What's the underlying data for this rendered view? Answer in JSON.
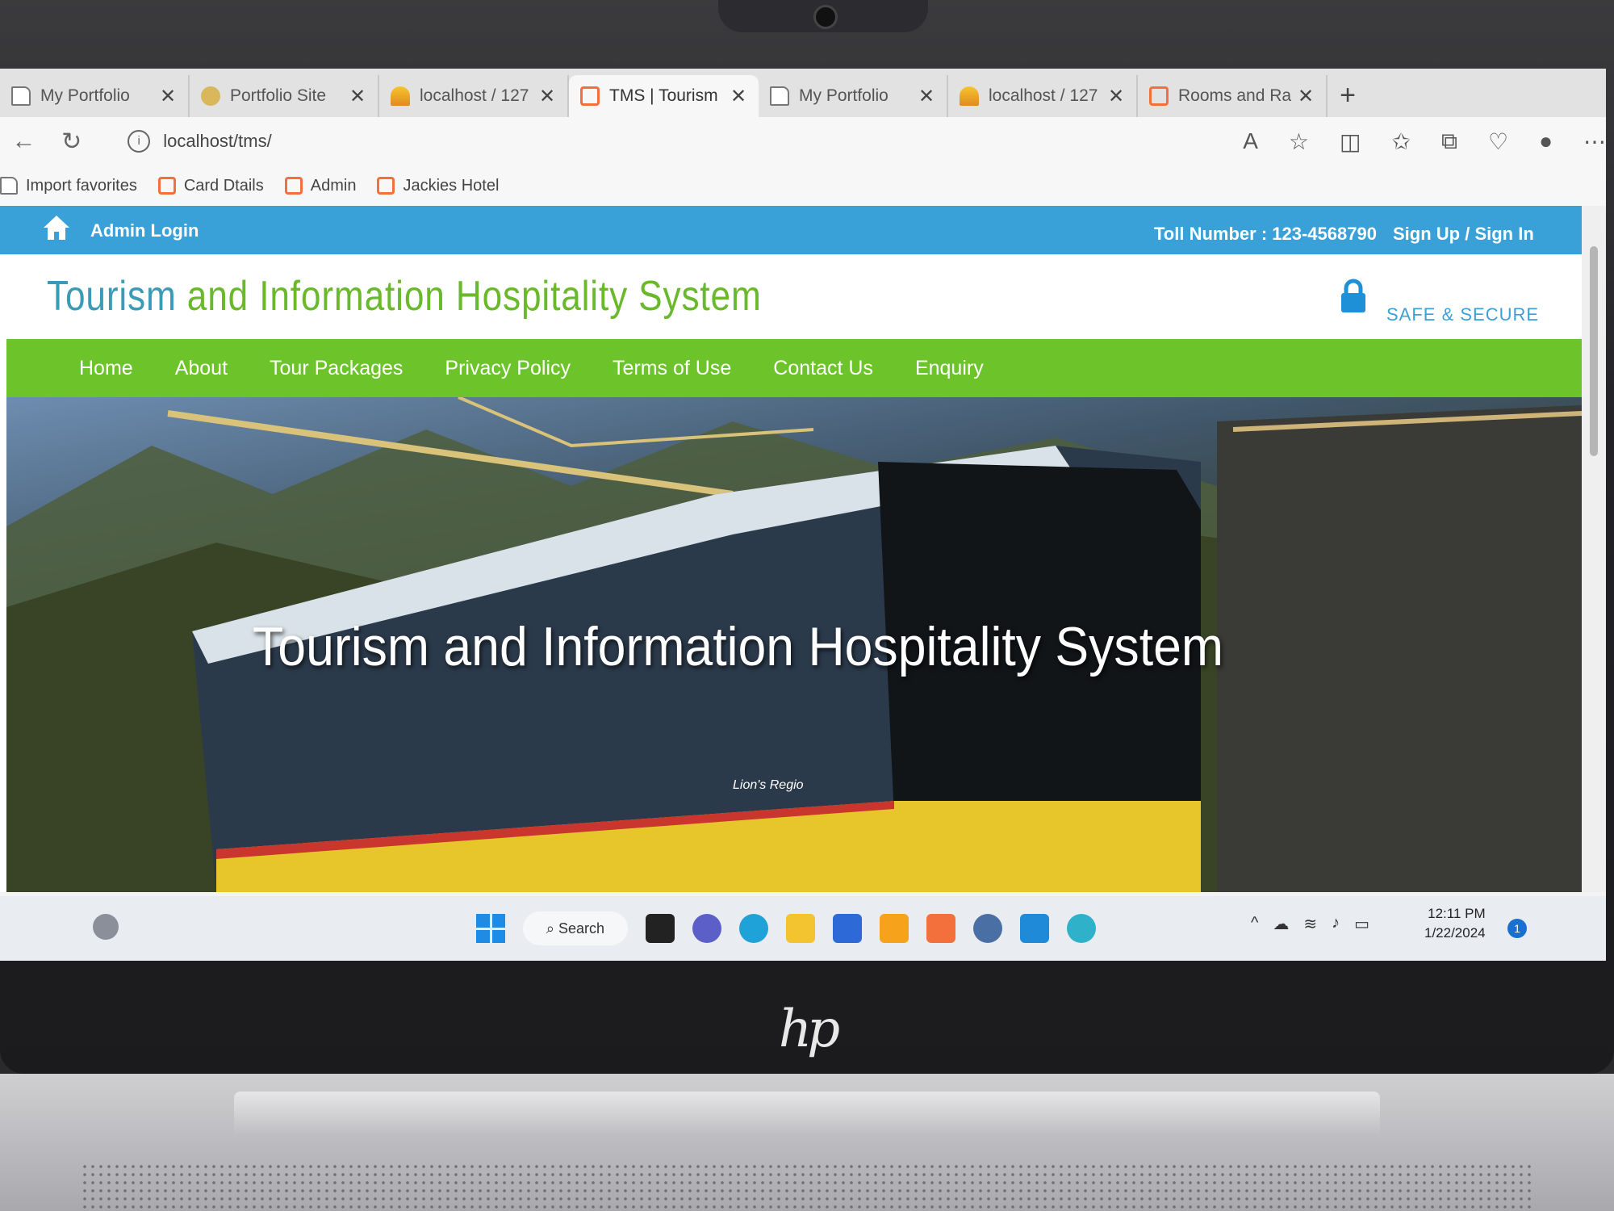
{
  "browser": {
    "tabs": [
      {
        "title": "My Portfolio",
        "favicon": "document-icon",
        "active": false
      },
      {
        "title": "Portfolio Site",
        "favicon": "site-icon",
        "active": false
      },
      {
        "title": "localhost / 127",
        "favicon": "phpmyadmin-icon",
        "active": false
      },
      {
        "title": "TMS | Tourism",
        "favicon": "xampp-icon",
        "active": true
      },
      {
        "title": "My Portfolio",
        "favicon": "document-icon",
        "active": false
      },
      {
        "title": "localhost / 127",
        "favicon": "phpmyadmin-icon",
        "active": false
      },
      {
        "title": "Rooms and Ra",
        "favicon": "xampp-icon",
        "active": false
      }
    ],
    "tab_close_glyph": "✕",
    "new_tab_glyph": "+",
    "address": "localhost/tms/",
    "favorites": [
      {
        "label": "Import favorites",
        "icon": "import-icon"
      },
      {
        "label": "Card Dtails",
        "icon": "xampp-icon"
      },
      {
        "label": "Admin",
        "icon": "xampp-icon"
      },
      {
        "label": "Jackies Hotel",
        "icon": "xampp-icon"
      }
    ]
  },
  "site": {
    "topbar": {
      "admin_login": "Admin Login",
      "toll_number": "Toll Number : 123-4568790",
      "signin": "Sign Up / Sign In"
    },
    "header": {
      "title_part_1": "Tourism",
      "title_part_2": " and Information Hospitality System",
      "badge": "SAFE & SECURE"
    },
    "nav": [
      "Home",
      "About",
      "Tour Packages",
      "Privacy Policy",
      "Terms of Use",
      "Contact Us",
      "Enquiry"
    ],
    "hero": {
      "title": "Tourism and Information Hospitality System",
      "bus_text": "Lion's Regio"
    }
  },
  "taskbar": {
    "search_label": "Search",
    "time": "12:11 PM",
    "date": "1/22/2024",
    "notification_count": "1"
  },
  "device": {
    "logo_text": "hp"
  },
  "colors": {
    "topbar": "#3aa0d8",
    "nav": "#6cc42a",
    "title_green": "#6ab92c",
    "title_blue": "#3b9ab5"
  }
}
